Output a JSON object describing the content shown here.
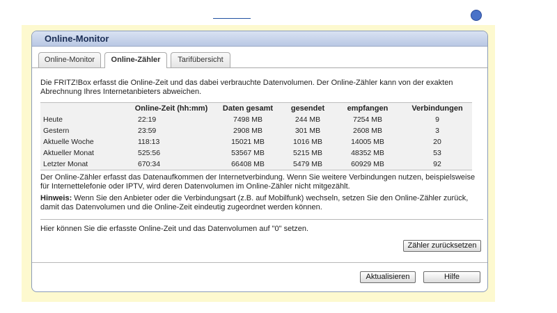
{
  "panel": {
    "title": "Online-Monitor"
  },
  "tabs": [
    {
      "label": "Online-Monitor"
    },
    {
      "label": "Online-Zähler"
    },
    {
      "label": "Tarifübersicht"
    }
  ],
  "intro": "Die FRITZ!Box erfasst die Online-Zeit und das dabei verbrauchte Datenvolumen. Der Online-Zähler kann von der exakten Abrechnung Ihres Internetanbieters abweichen.",
  "table": {
    "headers": [
      "",
      "Online-Zeit (hh:mm)",
      "Daten gesamt",
      "gesendet",
      "empfangen",
      "Verbindungen"
    ],
    "rows": [
      {
        "period": "Heute",
        "time": "22:19",
        "total": "7498 MB",
        "sent": "244 MB",
        "received": "7254 MB",
        "connections": "9"
      },
      {
        "period": "Gestern",
        "time": "23:59",
        "total": "2908 MB",
        "sent": "301 MB",
        "received": "2608 MB",
        "connections": "3"
      },
      {
        "period": "Aktuelle Woche",
        "time": "118:13",
        "total": "15021 MB",
        "sent": "1016 MB",
        "received": "14005 MB",
        "connections": "20"
      },
      {
        "period": "Aktueller Monat",
        "time": "525:56",
        "total": "53567 MB",
        "sent": "5215 MB",
        "received": "48352 MB",
        "connections": "53"
      },
      {
        "period": "Letzter Monat",
        "time": "670:34",
        "total": "66408 MB",
        "sent": "5479 MB",
        "received": "60929 MB",
        "connections": "92"
      }
    ]
  },
  "note": "Der Online-Zähler erfasst das Datenaufkommen der Internetverbindung. Wenn Sie weitere Verbindungen nutzen, beispielsweise für Internettelefonie oder IPTV, wird deren Datenvolumen im Online-Zähler nicht mitgezählt.",
  "hint": {
    "label": "Hinweis:",
    "text": "Wenn Sie den Anbieter oder die Verbindungsart (z.B. auf Mobilfunk) wechseln, setzen Sie den Online-Zähler zurück, damit das Datenvolumen und die Online-Zeit eindeutig zugeordnet werden können."
  },
  "reset": {
    "text": "Hier können Sie die erfasste Online-Zeit und das Datenvolumen auf \"0\" setzen.",
    "button": "Zähler zurücksetzen"
  },
  "footer": {
    "refresh": "Aktualisieren",
    "help": "Hilfe"
  }
}
